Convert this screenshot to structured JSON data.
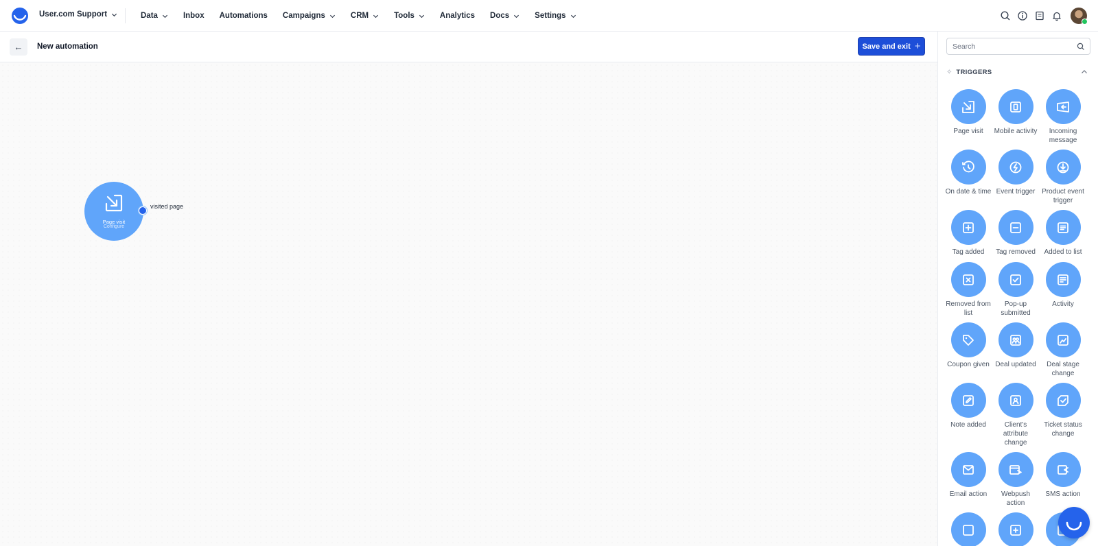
{
  "app": {
    "workspace": "User.com Support",
    "brand_color": "#2563eb"
  },
  "nav": {
    "items": [
      {
        "label": "Data",
        "dropdown": true
      },
      {
        "label": "Inbox",
        "dropdown": false
      },
      {
        "label": "Automations",
        "dropdown": false
      },
      {
        "label": "Campaigns",
        "dropdown": true
      },
      {
        "label": "CRM",
        "dropdown": true
      },
      {
        "label": "Tools",
        "dropdown": true
      },
      {
        "label": "Analytics",
        "dropdown": false
      },
      {
        "label": "Docs",
        "dropdown": true
      },
      {
        "label": "Settings",
        "dropdown": true
      }
    ]
  },
  "toolbar": {
    "back_label": "←",
    "title": "New automation",
    "save_label": "Save and exit",
    "save_plus": "+"
  },
  "canvas": {
    "node": {
      "title": "Page visit",
      "subtitle": "Configure",
      "output_label": "visited page",
      "color": "#60a5fa"
    }
  },
  "panel": {
    "search_placeholder": "Search",
    "section_title": "TRIGGERS",
    "section_icon": "✧",
    "tiles": [
      {
        "label": "Page visit",
        "icon": "page-visit"
      },
      {
        "label": "Mobile activity",
        "icon": "mobile"
      },
      {
        "label": "Incoming message",
        "icon": "incoming-message"
      },
      {
        "label": "On date & time",
        "icon": "clock"
      },
      {
        "label": "Event trigger",
        "icon": "bolt"
      },
      {
        "label": "Product event trigger",
        "icon": "download"
      },
      {
        "label": "Tag added",
        "icon": "plus-square"
      },
      {
        "label": "Tag removed",
        "icon": "minus-square"
      },
      {
        "label": "Added to list",
        "icon": "list"
      },
      {
        "label": "Removed from list",
        "icon": "x-square"
      },
      {
        "label": "Pop-up submitted",
        "icon": "check-square"
      },
      {
        "label": "Activity",
        "icon": "activity"
      },
      {
        "label": "Coupon given",
        "icon": "tag"
      },
      {
        "label": "Deal updated",
        "icon": "deal"
      },
      {
        "label": "Deal stage change",
        "icon": "deal-stage"
      },
      {
        "label": "Note added",
        "icon": "pencil"
      },
      {
        "label": "Client's attribute change",
        "icon": "client"
      },
      {
        "label": "Ticket status change",
        "icon": "ticket"
      },
      {
        "label": "Email action",
        "icon": "email"
      },
      {
        "label": "Webpush action",
        "icon": "webpush"
      },
      {
        "label": "SMS action",
        "icon": "sms"
      },
      {
        "label": "",
        "icon": "more-1"
      },
      {
        "label": "",
        "icon": "more-2"
      },
      {
        "label": "",
        "icon": "more-3"
      }
    ]
  }
}
